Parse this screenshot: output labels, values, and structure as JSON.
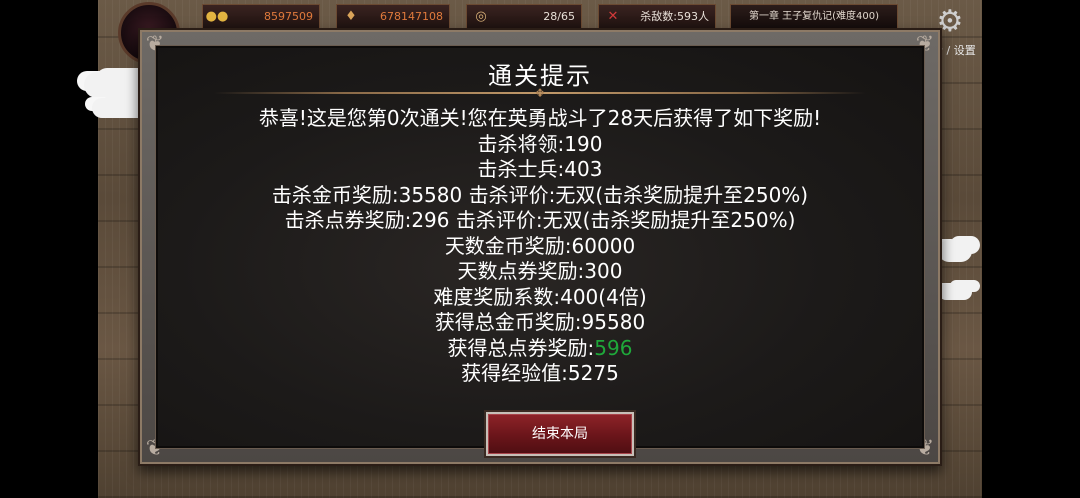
{
  "hud": {
    "gold": "8597509",
    "coupons": "678147108",
    "days": "28/65",
    "kills": "杀敌数:593人",
    "chapter": "第一章 王子复仇记(难度400)",
    "settings_label": "合 / 设置",
    "icons": [
      "gold-coins-icon",
      "money-bag-icon",
      "compass-icon",
      "crossed-swords-icon",
      "gear-icon"
    ]
  },
  "modal": {
    "title": "通关提示",
    "lines": [
      "恭喜!这是您第0次通关!您在英勇战斗了28天后获得了如下奖励!",
      "击杀将领:190",
      "击杀士兵:403",
      "击杀金币奖励:35580 击杀评价:无双(击杀奖励提升至250%)",
      "击杀点券奖励:296 击杀评价:无双(击杀奖励提升至250%)",
      "天数金币奖励:60000",
      "天数点券奖励:300",
      "难度奖励系数:400(4倍)",
      "获得总金币奖励:95580"
    ],
    "total_coupon_label": "获得总点券奖励:",
    "total_coupon_value": "596",
    "exp_line": "获得经验值:5275",
    "end_button": "结束本局"
  },
  "colors": {
    "highlight": "#1fa83a",
    "button": "#8e2328",
    "hud_value": "#e07a3c"
  }
}
